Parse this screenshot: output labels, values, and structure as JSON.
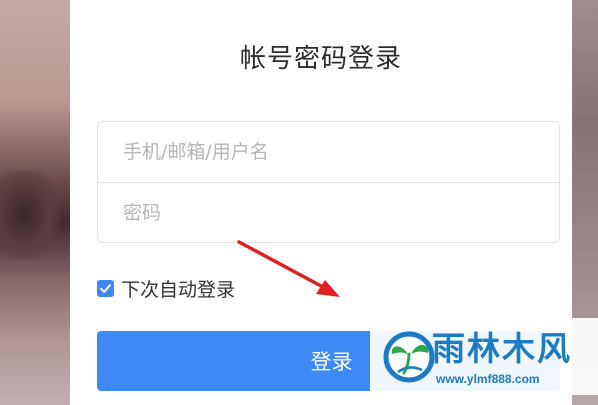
{
  "login": {
    "title": "帐号密码登录",
    "username_placeholder": "手机/邮箱/用户名",
    "password_placeholder": "密码",
    "remember_label": "下次自动登录",
    "remember_checked": true,
    "submit_label": "登录"
  },
  "watermark": {
    "name": "雨林木风",
    "url": "www.ylmf888.com"
  },
  "colors": {
    "accent": "#3d8af7",
    "annotation_arrow": "#e02020",
    "watermark": "#1b7bc4"
  },
  "icons": {
    "checkbox": "check-icon",
    "annotation": "red-arrow-icon",
    "watermark_logo": "ylmf-logo-icon"
  }
}
